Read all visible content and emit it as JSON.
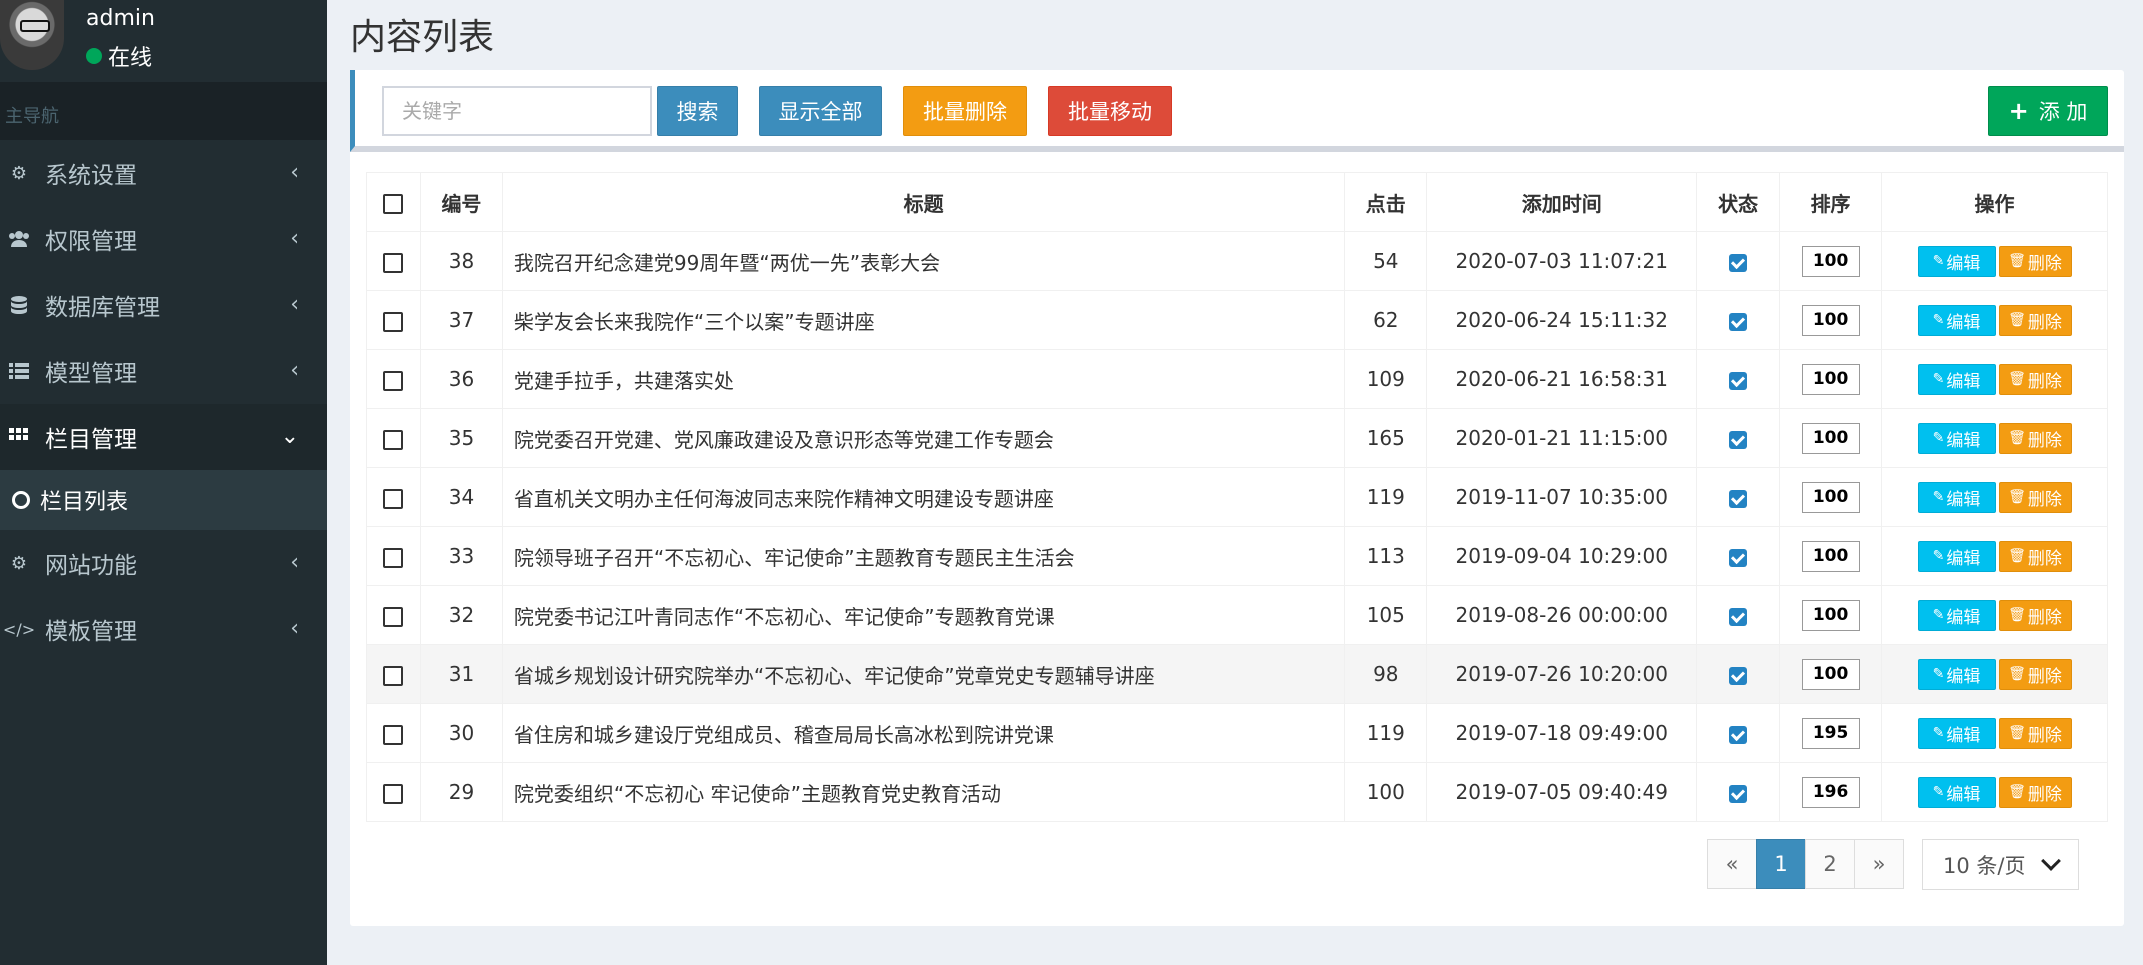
{
  "user": {
    "name": "admin",
    "status": "在线"
  },
  "nav": {
    "header": "主导航",
    "items": [
      {
        "label": "系统设置",
        "icon": "cogs-icon"
      },
      {
        "label": "权限管理",
        "icon": "users-icon"
      },
      {
        "label": "数据库管理",
        "icon": "database-icon"
      },
      {
        "label": "模型管理",
        "icon": "list-icon"
      },
      {
        "label": "栏目管理",
        "icon": "grid-icon"
      },
      {
        "label": "网站功能",
        "icon": "cog-icon"
      },
      {
        "label": "模板管理",
        "icon": "code-icon"
      }
    ],
    "sub_item": "栏目列表"
  },
  "page": {
    "title": "内容列表"
  },
  "toolbar": {
    "search_placeholder": "关键字",
    "search_label": "搜索",
    "show_all_label": "显示全部",
    "batch_delete_label": "批量删除",
    "batch_move_label": "批量移动",
    "add_label": "添 加"
  },
  "table": {
    "headers": {
      "id": "编号",
      "title": "标题",
      "clicks": "点击",
      "time": "添加时间",
      "status": "状态",
      "sort": "排序",
      "ops": "操作"
    },
    "edit_label": "编辑",
    "delete_label": "删除",
    "rows": [
      {
        "id": "38",
        "title": "我院召开纪念建党99周年暨“两优一先”表彰大会",
        "clicks": "54",
        "time": "2020-07-03 11:07:21",
        "sort": "100"
      },
      {
        "id": "37",
        "title": "柴学友会长来我院作“三个以案”专题讲座",
        "clicks": "62",
        "time": "2020-06-24 15:11:32",
        "sort": "100"
      },
      {
        "id": "36",
        "title": "党建手拉手，共建落实处",
        "clicks": "109",
        "time": "2020-06-21 16:58:31",
        "sort": "100"
      },
      {
        "id": "35",
        "title": "院党委召开党建、党风廉政建设及意识形态等党建工作专题会",
        "clicks": "165",
        "time": "2020-01-21 11:15:00",
        "sort": "100"
      },
      {
        "id": "34",
        "title": "省直机关文明办主任何海波同志来院作精神文明建设专题讲座",
        "clicks": "119",
        "time": "2019-11-07 10:35:00",
        "sort": "100"
      },
      {
        "id": "33",
        "title": "院领导班子召开“不忘初心、牢记使命”主题教育专题民主生活会",
        "clicks": "113",
        "time": "2019-09-04 10:29:00",
        "sort": "100"
      },
      {
        "id": "32",
        "title": "院党委书记江叶青同志作“不忘初心、牢记使命”专题教育党课",
        "clicks": "105",
        "time": "2019-08-26 00:00:00",
        "sort": "100"
      },
      {
        "id": "31",
        "title": "省城乡规划设计研究院举办“不忘初心、牢记使命”党章党史专题辅导讲座",
        "clicks": "98",
        "time": "2019-07-26 10:20:00",
        "sort": "100"
      },
      {
        "id": "30",
        "title": "省住房和城乡建设厅党组成员、稽查局局长高冰松到院讲党课",
        "clicks": "119",
        "time": "2019-07-18 09:49:00",
        "sort": "195"
      },
      {
        "id": "29",
        "title": "院党委组织“不忘初心 牢记使命”主题教育党史教育活动",
        "clicks": "100",
        "time": "2019-07-05 09:40:49",
        "sort": "196"
      }
    ]
  },
  "pagination": {
    "prev": "«",
    "pages": [
      "1",
      "2"
    ],
    "next": "»",
    "per_page": "10 条/页"
  },
  "colors": {
    "sidebar": "#222d32",
    "primary": "#3c8dbc",
    "warning": "#f39c12",
    "danger": "#dd4b39",
    "success": "#00a65a",
    "info": "#00c0ef"
  }
}
